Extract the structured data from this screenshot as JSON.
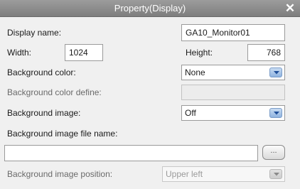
{
  "dialog": {
    "title": "Property(Display)",
    "close_symbol": "✕"
  },
  "fields": {
    "display_name": {
      "label": "Display name:",
      "value": "GA10_Monitor01"
    },
    "width": {
      "label": "Width:",
      "value": "1024"
    },
    "height": {
      "label": "Height:",
      "value": "768"
    },
    "background_color": {
      "label": "Background color:",
      "value": "None"
    },
    "background_color_define": {
      "label": "Background color define:",
      "value": ""
    },
    "background_image": {
      "label": "Background image:",
      "value": "Off"
    },
    "background_image_file_name": {
      "label": "Background image file name:",
      "value": "",
      "browse_label": "..."
    },
    "background_image_position": {
      "label": "Background image position:",
      "value": "Upper left"
    }
  },
  "icons": {
    "close": "close-icon",
    "dropdown": "chevron-down-icon"
  }
}
